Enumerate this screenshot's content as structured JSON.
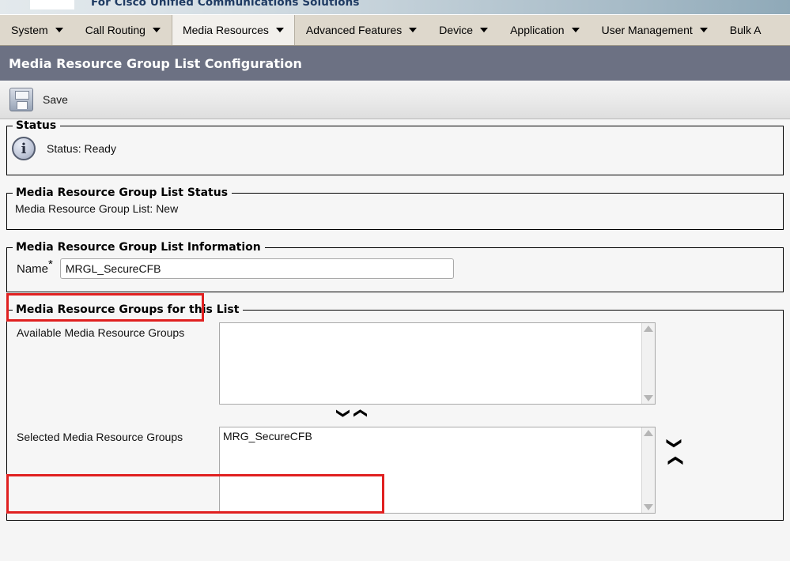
{
  "banner": {
    "tagline": "For Cisco Unified Communications Solutions",
    "logo_name": "cisco-logo"
  },
  "menubar": {
    "items": [
      {
        "label": "System",
        "active": false
      },
      {
        "label": "Call Routing",
        "active": false
      },
      {
        "label": "Media Resources",
        "active": true
      },
      {
        "label": "Advanced Features",
        "active": false
      },
      {
        "label": "Device",
        "active": false
      },
      {
        "label": "Application",
        "active": false
      },
      {
        "label": "User Management",
        "active": false
      },
      {
        "label": "Bulk A",
        "active": false
      }
    ]
  },
  "page": {
    "title": "Media Resource Group List Configuration"
  },
  "toolbar": {
    "save_label": "Save",
    "save_icon": "floppy-disk-icon"
  },
  "status_section": {
    "legend": "Status",
    "icon": "info-icon",
    "text": "Status: Ready"
  },
  "mrgl_status_section": {
    "legend": "Media Resource Group List Status",
    "text": "Media Resource Group List: New"
  },
  "mrgl_info_section": {
    "legend": "Media Resource Group List Information",
    "name_label": "Name",
    "required_marker": "*",
    "name_value": "MRGL_SecureCFB",
    "name_placeholder": ""
  },
  "groups_section": {
    "legend": "Media Resource Groups for this List",
    "available_label": "Available Media Resource Groups",
    "available_items": [],
    "selected_label": "Selected Media Resource Groups",
    "selected_items": [
      "MRG_SecureCFB"
    ],
    "move_down_icon": "chevron-down-icon",
    "move_up_icon": "chevron-up-icon",
    "reorder_down_icon": "chevron-down-icon",
    "reorder_up_icon": "chevron-up-icon"
  },
  "annotations": {
    "highlight_color": "#e02020",
    "boxes": [
      "name-field-highlight",
      "selected-groups-highlight"
    ]
  },
  "glyphs": {
    "chevron_down": "❯",
    "chevron_up": "❯",
    "info_letter": "i"
  }
}
